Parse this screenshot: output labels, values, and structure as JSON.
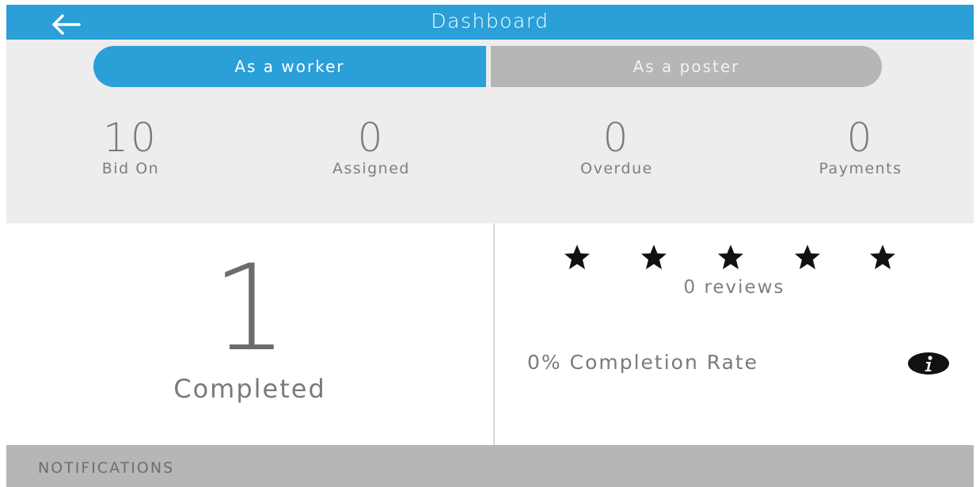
{
  "header": {
    "title": "Dashboard",
    "back_icon": "arrow-left-icon"
  },
  "toggle": {
    "worker_label": "As a worker",
    "poster_label": "As a poster",
    "selected": "As a worker"
  },
  "stats": [
    {
      "value": "10",
      "label": "Bid On"
    },
    {
      "value": "0",
      "label": "Assigned"
    },
    {
      "value": "0",
      "label": "Overdue"
    },
    {
      "value": "0",
      "label": "Payments"
    }
  ],
  "completed": {
    "value": "1",
    "label": "Completed"
  },
  "rating": {
    "stars_total": 5,
    "reviews_text": "0 reviews"
  },
  "completion_rate": {
    "text": "0% Completion Rate",
    "info_icon": "info-icon"
  },
  "notifications": {
    "label": "NOTIFICATIONS"
  },
  "colors": {
    "accent": "#2a9fd8",
    "inactive": "#b6b6b6",
    "panel_bg": "#ededed"
  }
}
